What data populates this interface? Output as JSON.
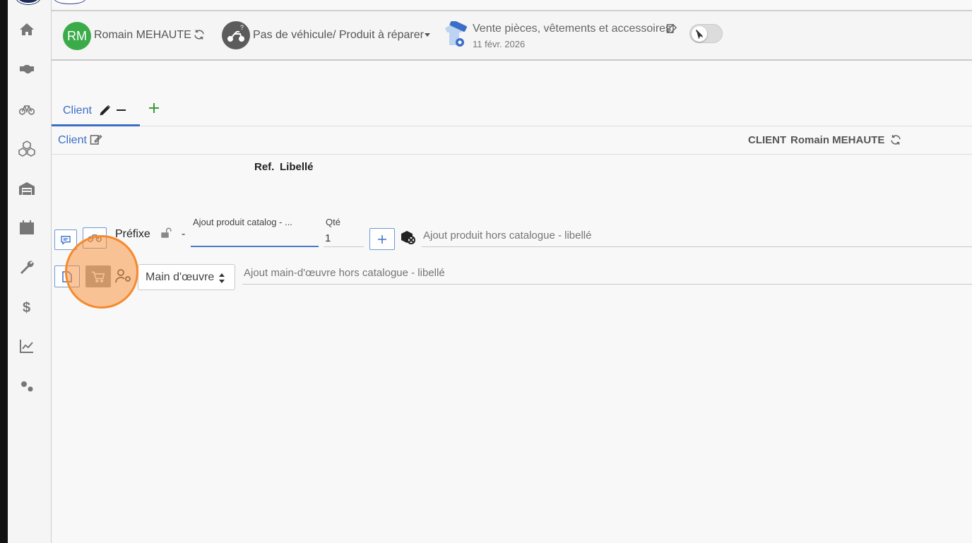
{
  "sidebar": {
    "items": [
      {
        "name": "home",
        "icon": "home-icon"
      },
      {
        "name": "handshake",
        "icon": "handshake-icon"
      },
      {
        "name": "bicycle",
        "icon": "bicycle-icon"
      },
      {
        "name": "boxes",
        "icon": "boxes-icon"
      },
      {
        "name": "warehouse",
        "icon": "warehouse-icon"
      },
      {
        "name": "calendar",
        "icon": "calendar-icon"
      },
      {
        "name": "wrench",
        "icon": "wrench-icon"
      },
      {
        "name": "dollar",
        "icon": "dollar-icon"
      },
      {
        "name": "chart",
        "icon": "line-chart-icon"
      },
      {
        "name": "settings",
        "icon": "gears-icon"
      }
    ]
  },
  "header": {
    "avatar_initials": "RM",
    "client_name": "Romain MEHAUTE",
    "vehicle_label": "Pas de véhicule/ Produit à réparer",
    "moto_badge": "?",
    "sale_title": "Vente pièces, vêtements et accessoires",
    "sale_date": "11 févr. 2026"
  },
  "tabs": {
    "client_label": "Client"
  },
  "subheader": {
    "client_link": "Client",
    "right_label": "CLIENT",
    "right_name": "Romain MEHAUTE"
  },
  "table": {
    "col_ref": "Ref.",
    "col_libelle": "Libellé"
  },
  "product_row": {
    "prefix_label": "Préfixe",
    "dash": "-",
    "catalog_label": "Ajout produit catalog - ...",
    "qty_label": "Qté",
    "qty_value": "1",
    "hors_catalogue_placeholder": "Ajout produit hors catalogue - libellé"
  },
  "labour_row": {
    "select_value": "Main d'œuvre",
    "hors_catalogue_placeholder": "Ajout main-d'œuvre hors catalogue - libellé"
  },
  "colors": {
    "accent": "#3b6fc7",
    "avatar": "#3bab4a",
    "highlight": "#f58a2e"
  }
}
